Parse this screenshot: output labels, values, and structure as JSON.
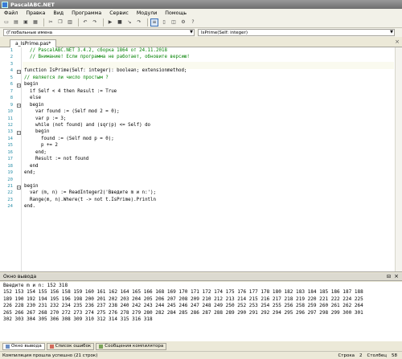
{
  "window": {
    "title": "PascalABC.NET"
  },
  "menu": [
    "Файл",
    "Правка",
    "Вид",
    "Программа",
    "Сервис",
    "Модули",
    "Помощь"
  ],
  "toolbar": {
    "icons": [
      "new-file-icon",
      "open-icon",
      "save-icon",
      "save-all-icon",
      "cut-icon",
      "copy-icon",
      "paste-icon",
      "undo-icon",
      "redo-icon",
      "run-icon",
      "stop-icon",
      "step-into-icon",
      "step-over-icon",
      "format-icon",
      "view-toggle-icon",
      "debug-icon",
      "compile-icon",
      "help-icon"
    ]
  },
  "combos": {
    "left_value": "(Глобальные имена",
    "right_value": "IsPrime(Self: integer)"
  },
  "file_tab": {
    "label": "a_IsPrime.pas*"
  },
  "code_lines": [
    {
      "ln": "1",
      "text": "  // PascalABC.NET 3.4.2, сборка 1864 от 24.11.2018",
      "color": "#008000"
    },
    {
      "ln": "2",
      "text": "  // Внимание! Если программа не работает, обновите версию!",
      "color": "#008000"
    },
    {
      "ln": "3",
      "text": "",
      "color": "#000000"
    },
    {
      "ln": "4",
      "text": "function IsPrime(Self: integer): boolean; extensionmethod;",
      "color": "#000000"
    },
    {
      "ln": "5",
      "text": "// является ли число простым ?",
      "color": "#008000"
    },
    {
      "ln": "6",
      "text": "begin",
      "color": "#000000"
    },
    {
      "ln": "7",
      "text": "  if Self < 4 then Result := True",
      "color": "#000000"
    },
    {
      "ln": "8",
      "text": "  else",
      "color": "#000000"
    },
    {
      "ln": "9",
      "text": "  begin",
      "color": "#000000"
    },
    {
      "ln": "10",
      "text": "    var found := (Self mod 2 = 0);",
      "color": "#000000"
    },
    {
      "ln": "11",
      "text": "    var p := 3;",
      "color": "#000000"
    },
    {
      "ln": "12",
      "text": "    while (not found) and (sqr(p) <= Self) do",
      "color": "#000000"
    },
    {
      "ln": "13",
      "text": "    begin",
      "color": "#000000"
    },
    {
      "ln": "14",
      "text": "      found := (Self mod p = 0);",
      "color": "#000000"
    },
    {
      "ln": "15",
      "text": "      p += 2",
      "color": "#000000"
    },
    {
      "ln": "16",
      "text": "    end;",
      "color": "#000000"
    },
    {
      "ln": "17",
      "text": "    Result := not found",
      "color": "#000000"
    },
    {
      "ln": "18",
      "text": "  end",
      "color": "#000000"
    },
    {
      "ln": "19",
      "text": "end;",
      "color": "#000000"
    },
    {
      "ln": "20",
      "text": "",
      "color": "#000000"
    },
    {
      "ln": "21",
      "text": "begin",
      "color": "#000000"
    },
    {
      "ln": "22",
      "text": "  var (m, n) := ReadInteger2('Введите m и n:');",
      "color": "#000000"
    },
    {
      "ln": "23",
      "text": "  Range(m, n).Where(t -> not t.IsPrime).Println",
      "color": "#000000"
    },
    {
      "ln": "24",
      "text": "end.",
      "color": "#000000"
    }
  ],
  "output_panel": {
    "title": "Окно вывода",
    "lines": [
      "Введите m и n: 152 318",
      "152 153 154 155 156 158 159 160 161 162 164 165 166 168 169 170 171 172 174 175 176 177 178 180 182 183 184 185 186 187 188",
      "189 190 192 194 195 196 198 200 201 202 203 204 205 206 207 208 209 210 212 213 214 215 216 217 218 219 220 221 222 224 225",
      "226 228 230 231 232 234 235 236 237 238 240 242 243 244 245 246 247 248 249 250 252 253 254 255 256 258 259 260 261 262 264",
      "265 266 267 268 270 272 273 274 275 276 278 279 280 282 284 285 286 287 288 289 290 291 292 294 295 296 297 298 299 300 301",
      "302 303 304 305 306 308 309 310 312 314 315 316 318"
    ]
  },
  "bottom_tabs": [
    "Окно вывода",
    "Список ошибок",
    "Сообщения компилятора"
  ],
  "status": {
    "message": "Компиляция прошла успешно (21 строк)",
    "row_label": "Строка",
    "row_value": "2",
    "col_label": "Столбец",
    "col_value": "58"
  }
}
